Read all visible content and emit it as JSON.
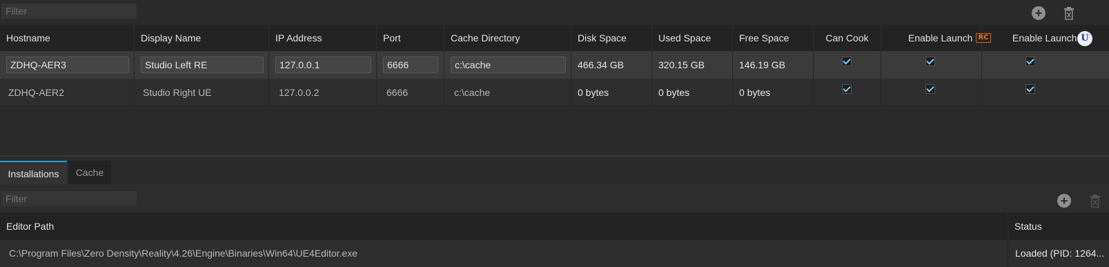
{
  "servers": {
    "filter_placeholder": "Filter",
    "columns": [
      "Hostname",
      "Display Name",
      "IP Address",
      "Port",
      "Cache Directory",
      "Disk Space",
      "Used Space",
      "Free Space",
      "Can Cook",
      "Enable Launch",
      "Enable Launch"
    ],
    "rows": [
      {
        "hostname": "ZDHQ-AER3",
        "display_name": "Studio Left RE",
        "ip": "127.0.0.1",
        "port": "6666",
        "cache_dir": "c:\\cache",
        "disk_space": "466.34 GB",
        "used_space": "320.15 GB",
        "free_space": "146.19 GB",
        "can_cook": true,
        "enable_launch_rc": true,
        "enable_launch_ue": true
      },
      {
        "hostname": "ZDHQ-AER2",
        "display_name": "Studio Right UE",
        "ip": "127.0.0.2",
        "port": "6666",
        "cache_dir": "c:\\cache",
        "disk_space": "0 bytes",
        "used_space": "0 bytes",
        "free_space": "0 bytes",
        "can_cook": true,
        "enable_launch_rc": true,
        "enable_launch_ue": true
      }
    ],
    "icons": {
      "add": "add-circle-icon",
      "delete": "trash-icon",
      "rc_logo": "RC",
      "ue_logo": "U"
    }
  },
  "tabs": [
    {
      "label": "Installations",
      "active": true
    },
    {
      "label": "Cache",
      "active": false
    }
  ],
  "installations": {
    "filter_placeholder": "Filter",
    "columns": [
      "Editor Path",
      "Status"
    ],
    "rows": [
      {
        "editor_path": "C:\\Program Files\\Zero Density\\Reality\\4.26\\Engine\\Binaries\\Win64\\UE4Editor.exe",
        "status": "Loaded (PID: 1264..."
      }
    ]
  },
  "colors": {
    "accent": "#2a9fd6",
    "checkmark": "#7fd3ff",
    "rc_orange": "#e07a2a"
  }
}
